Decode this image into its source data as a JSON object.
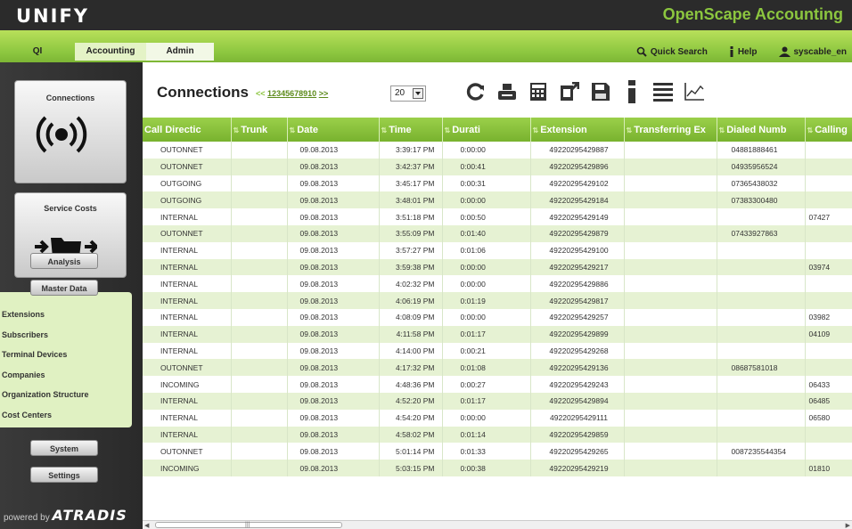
{
  "header": {
    "logo": "UNIFY",
    "product_title": "OpenScape Accounting"
  },
  "nav": {
    "tabs": [
      {
        "label": "QI"
      },
      {
        "label": "Accounting"
      },
      {
        "label": "Admin"
      }
    ],
    "quick_search": "Quick Search",
    "help": "Help",
    "user": "syscable_en"
  },
  "sidebar": {
    "connections_label": "Connections",
    "service_costs_label": "Service Costs",
    "analysis": "Analysis",
    "master_data": "Master Data",
    "submenu": [
      "Extensions",
      "Subscribers",
      "Terminal Devices",
      "Companies",
      "Organization Structure",
      "Cost Centers"
    ],
    "system": "System",
    "settings": "Settings",
    "powered_prefix": "powered by",
    "powered_brand": "ATRADIS"
  },
  "main": {
    "title": "Connections",
    "pager_prev": "<<",
    "pager_pages": [
      "1",
      "2",
      "3",
      "4",
      "5",
      "6",
      "7",
      "8",
      "9",
      "10"
    ],
    "pager_next": ">>",
    "page_size": "20"
  },
  "toolbar_icons": [
    "refresh-icon",
    "print-icon",
    "calculator-icon",
    "export-icon",
    "save-icon",
    "info-icon",
    "list-icon",
    "chart-icon"
  ],
  "table": {
    "columns": [
      "Call Directic",
      "Trunk",
      "Date",
      "Time",
      "Durati",
      "Extension",
      "Transferring Ex",
      "Dialed Numb",
      "Calling"
    ],
    "rows": [
      [
        "OUTONNET",
        "",
        "09.08.2013",
        "3:39:17 PM",
        "0:00:00",
        "49220295429887",
        "",
        "04881888461",
        ""
      ],
      [
        "OUTONNET",
        "",
        "09.08.2013",
        "3:42:37 PM",
        "0:00:41",
        "49220295429896",
        "",
        "04935956524",
        ""
      ],
      [
        "OUTGOING",
        "",
        "09.08.2013",
        "3:45:17 PM",
        "0:00:31",
        "49220295429102",
        "",
        "07365438032",
        ""
      ],
      [
        "OUTGOING",
        "",
        "09.08.2013",
        "3:48:01 PM",
        "0:00:00",
        "49220295429184",
        "",
        "07383300480",
        ""
      ],
      [
        "INTERNAL",
        "",
        "09.08.2013",
        "3:51:18 PM",
        "0:00:50",
        "49220295429149",
        "",
        "",
        "07427"
      ],
      [
        "OUTONNET",
        "",
        "09.08.2013",
        "3:55:09 PM",
        "0:01:40",
        "49220295429879",
        "",
        "07433927863",
        ""
      ],
      [
        "INTERNAL",
        "",
        "09.08.2013",
        "3:57:27 PM",
        "0:01:06",
        "49220295429100",
        "",
        "",
        ""
      ],
      [
        "INTERNAL",
        "",
        "09.08.2013",
        "3:59:38 PM",
        "0:00:00",
        "49220295429217",
        "",
        "",
        "03974"
      ],
      [
        "INTERNAL",
        "",
        "09.08.2013",
        "4:02:32 PM",
        "0:00:00",
        "49220295429886",
        "",
        "",
        ""
      ],
      [
        "INTERNAL",
        "",
        "09.08.2013",
        "4:06:19 PM",
        "0:01:19",
        "49220295429817",
        "",
        "",
        ""
      ],
      [
        "INTERNAL",
        "",
        "09.08.2013",
        "4:08:09 PM",
        "0:00:00",
        "49220295429257",
        "",
        "",
        "03982"
      ],
      [
        "INTERNAL",
        "",
        "09.08.2013",
        "4:11:58 PM",
        "0:01:17",
        "49220295429899",
        "",
        "",
        "04109"
      ],
      [
        "INTERNAL",
        "",
        "09.08.2013",
        "4:14:00 PM",
        "0:00:21",
        "49220295429268",
        "",
        "",
        ""
      ],
      [
        "OUTONNET",
        "",
        "09.08.2013",
        "4:17:32 PM",
        "0:01:08",
        "49220295429136",
        "",
        "08687581018",
        ""
      ],
      [
        "INCOMING",
        "",
        "09.08.2013",
        "4:48:36 PM",
        "0:00:27",
        "49220295429243",
        "",
        "",
        "06433"
      ],
      [
        "INTERNAL",
        "",
        "09.08.2013",
        "4:52:20 PM",
        "0:01:17",
        "49220295429894",
        "",
        "",
        "06485"
      ],
      [
        "INTERNAL",
        "",
        "09.08.2013",
        "4:54:20 PM",
        "0:00:00",
        "49220295429111",
        "",
        "",
        "06580"
      ],
      [
        "INTERNAL",
        "",
        "09.08.2013",
        "4:58:02 PM",
        "0:01:14",
        "49220295429859",
        "",
        "",
        ""
      ],
      [
        "OUTONNET",
        "",
        "09.08.2013",
        "5:01:14 PM",
        "0:01:33",
        "49220295429265",
        "",
        "0087235544354",
        ""
      ],
      [
        "INCOMING",
        "",
        "09.08.2013",
        "5:03:15 PM",
        "0:00:38",
        "49220295429219",
        "",
        "",
        "01810"
      ]
    ]
  },
  "colors": {
    "brand_green": "#8cc63f",
    "header_dark": "#2b2b2b",
    "row_alt": "#e6f2d3"
  }
}
